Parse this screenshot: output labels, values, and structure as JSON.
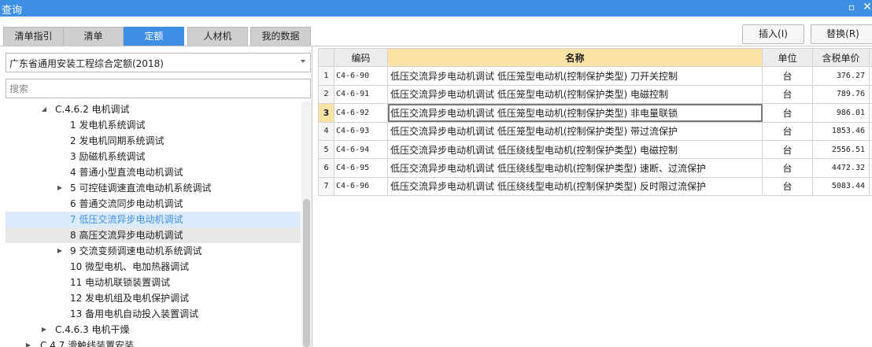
{
  "window": {
    "title": "查询",
    "maximize_icon": "maximize-icon",
    "close_icon": "close-icon",
    "accent": "#3d8fe3"
  },
  "tabs": [
    {
      "label": "清单指引",
      "active": false
    },
    {
      "label": "清单",
      "active": false
    },
    {
      "label": "定额",
      "active": true
    },
    {
      "label": "人材机",
      "active": false
    },
    {
      "label": "我的数据",
      "active": false
    }
  ],
  "toolbar": {
    "insert_label": "插入(I)",
    "replace_label": "替换(R)"
  },
  "left": {
    "quota_select": "广东省通用安装工程综合定额(2018)",
    "search_placeholder": "搜索",
    "tree": [
      {
        "label": "C.4.6.2 电机调试",
        "expander": "◢"
      },
      {
        "label": "1 发电机系统调试",
        "expander": ""
      },
      {
        "label": "2 发电机同期系统调试",
        "expander": ""
      },
      {
        "label": "3 励磁机系统调试",
        "expander": ""
      },
      {
        "label": "4 普通小型直流电动机调试",
        "expander": ""
      },
      {
        "label": "5 可控硅调速直流电动机系统调试",
        "expander": "▶"
      },
      {
        "label": "6 普通交流同步电动机调试",
        "expander": ""
      },
      {
        "label": "7 低压交流异步电动机调试",
        "expander": ""
      },
      {
        "label": "8 高压交流异步电动机调试",
        "expander": ""
      },
      {
        "label": "9 交流变频调速电动机系统调试",
        "expander": "▶"
      },
      {
        "label": "10 微型电机、电加热器调试",
        "expander": ""
      },
      {
        "label": "11 电动机联锁装置调试",
        "expander": ""
      },
      {
        "label": "12 发电机组及电机保护调试",
        "expander": ""
      },
      {
        "label": "13 备用电机自动投入装置调试",
        "expander": ""
      },
      {
        "label": "C.4.6.3 电机干燥",
        "expander": "▶"
      },
      {
        "label": "C.4.7 滑触线装置安装",
        "expander": "▶"
      }
    ]
  },
  "grid": {
    "columns": {
      "code": "编码",
      "name": "名称",
      "unit": "单位",
      "price": "含税单价"
    },
    "rows": [
      {
        "num": "1",
        "code": "C4-6-90",
        "name": "低压交流异步电动机调试 低压笼型电动机(控制保护类型) 刀开关控制",
        "unit": "台",
        "price": "376.27"
      },
      {
        "num": "2",
        "code": "C4-6-91",
        "name": "低压交流异步电动机调试 低压笼型电动机(控制保护类型) 电磁控制",
        "unit": "台",
        "price": "789.76"
      },
      {
        "num": "3",
        "code": "C4-6-92",
        "name": "低压交流异步电动机调试 低压笼型电动机(控制保护类型) 非电量联锁",
        "unit": "台",
        "price": "986.01"
      },
      {
        "num": "4",
        "code": "C4-6-93",
        "name": "低压交流异步电动机调试 低压笼型电动机(控制保护类型) 带过流保护",
        "unit": "台",
        "price": "1853.46"
      },
      {
        "num": "5",
        "code": "C4-6-94",
        "name": "低压交流异步电动机调试 低压绕线型电动机(控制保护类型) 电磁控制",
        "unit": "台",
        "price": "2556.51"
      },
      {
        "num": "6",
        "code": "C4-6-95",
        "name": "低压交流异步电动机调试 低压绕线型电动机(控制保护类型) 速断、过流保护",
        "unit": "台",
        "price": "4472.32"
      },
      {
        "num": "7",
        "code": "C4-6-96",
        "name": "低压交流异步电动机调试 低压绕线型电动机(控制保护类型) 反时限过流保护",
        "unit": "台",
        "price": "5083.44"
      }
    ]
  }
}
